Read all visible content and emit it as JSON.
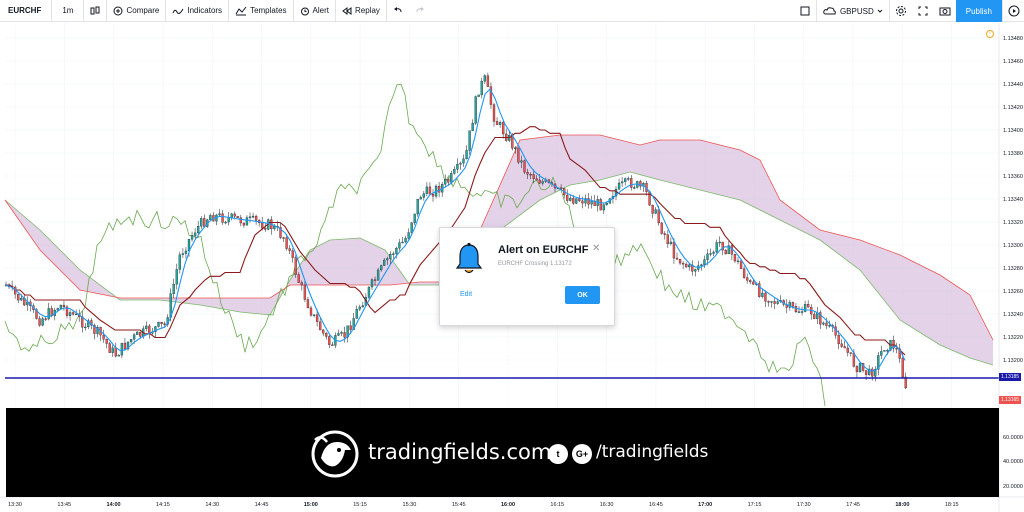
{
  "toolbar": {
    "symbol": "EURCHF",
    "interval": "1m",
    "compare": "Compare",
    "indicators": "Indicators",
    "templates": "Templates",
    "alert": "Alert",
    "replay": "Replay",
    "currency": "GBPUSD",
    "publish": "Publish"
  },
  "price_axis": {
    "ticks": [
      "1.13480",
      "1.13460",
      "1.13440",
      "1.13420",
      "1.13400",
      "1.13380",
      "1.13360",
      "1.13340",
      "1.13320",
      "1.13300",
      "1.13280",
      "1.13260",
      "1.13240",
      "1.13220",
      "1.13200"
    ],
    "current_line_label": "1.13185",
    "last_price_label": "1.13165",
    "osc_ticks": [
      "60.0000",
      "40.0000",
      "20.0000"
    ]
  },
  "time_axis": {
    "ticks": [
      "13:30",
      "13:45",
      "14:00",
      "14:15",
      "14:30",
      "14:45",
      "15:00",
      "15:15",
      "15:30",
      "15:45",
      "16:00",
      "16:15",
      "16:30",
      "16:45",
      "17:00",
      "17:15",
      "17:30",
      "17:45",
      "18:00",
      "18:15"
    ],
    "bold": [
      "14:00",
      "15:00",
      "16:00",
      "17:00",
      "18:00"
    ]
  },
  "alert_dialog": {
    "title": "Alert on EURCHF",
    "subtitle": "EURCHF Crossing 1.13172",
    "edit": "Edit",
    "ok": "OK"
  },
  "banner": {
    "site": "tradingfields.com",
    "twitter": "t",
    "gplus": "G+",
    "handle": "/tradingfields"
  },
  "colors": {
    "up": "#26a69a",
    "down": "#ef5350",
    "kijun": "#8b1a1a",
    "tenkan": "#2196f3",
    "chikou": "#6aa84f",
    "cloud": "#d9c3e0",
    "alert_line": "#1a1aa8",
    "accent": "#2196f3"
  }
}
